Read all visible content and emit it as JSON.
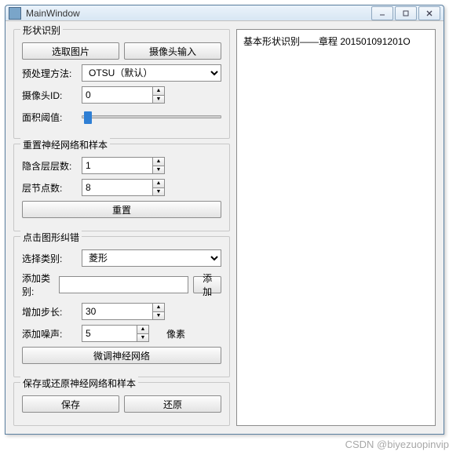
{
  "window": {
    "title": "MainWindow"
  },
  "group_shape": {
    "title": "形状识别",
    "select_image_btn": "选取图片",
    "camera_input_btn": "摄像头输入",
    "preprocess_label": "预处理方法:",
    "preprocess_value": "OTSU（默认）",
    "camera_id_label": "摄像头ID:",
    "camera_id_value": "0",
    "area_threshold_label": "面积阈值:"
  },
  "group_reset": {
    "title": "重置神经网络和样本",
    "hidden_layers_label": "隐含层层数:",
    "hidden_layers_value": "1",
    "layer_nodes_label": "层节点数:",
    "layer_nodes_value": "8",
    "reset_btn": "重置"
  },
  "group_correct": {
    "title": "点击图形纠错",
    "select_class_label": "选择类别:",
    "select_class_value": "菱形",
    "add_class_label": "添加类别:",
    "add_class_value": "",
    "add_btn": "添加",
    "step_label": "增加步长:",
    "step_value": "30",
    "noise_label": "添加噪声:",
    "noise_value": "5",
    "pixel_suffix": "像素",
    "finetune_btn": "微调神经网络"
  },
  "group_save": {
    "title": "保存或还原神经网络和样本",
    "save_btn": "保存",
    "restore_btn": "还原"
  },
  "output": {
    "text": "基本形状识别——章程 201501091201O"
  },
  "watermark": "CSDN @biyezuopinvip"
}
